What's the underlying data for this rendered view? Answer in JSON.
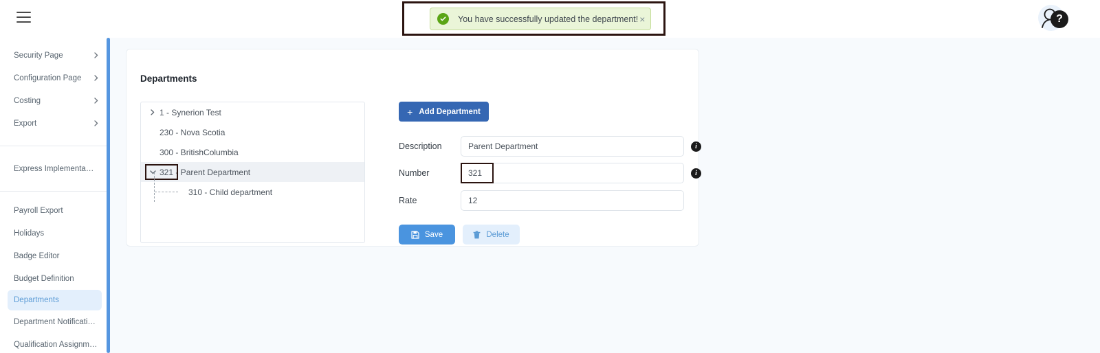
{
  "topbar": {
    "menu_icon": "hamburger-icon",
    "avatar_icon": "user-avatar-icon",
    "help_badge": "?"
  },
  "toast": {
    "message": "You have successfully updated the department!",
    "close_label": "×",
    "status_icon": "check-circle-icon",
    "bg_color": "#eaf5d8",
    "border_color": "#c5dd9a",
    "check_color": "#5aa515"
  },
  "sidebar": {
    "group_expandable": [
      {
        "label": "Security Page",
        "chevron": "chevron-right-icon"
      },
      {
        "label": "Configuration Page",
        "chevron": "chevron-right-icon"
      },
      {
        "label": "Costing",
        "chevron": "chevron-right-icon"
      },
      {
        "label": "Export",
        "chevron": "chevron-right-icon"
      }
    ],
    "group_express": [
      {
        "label": "Express Implementation P..."
      }
    ],
    "group_pages": [
      {
        "label": "Payroll Export",
        "active": false
      },
      {
        "label": "Holidays",
        "active": false
      },
      {
        "label": "Badge Editor",
        "active": false
      },
      {
        "label": "Budget Definition",
        "active": false
      },
      {
        "label": "Departments",
        "active": true
      },
      {
        "label": "Department Notifications",
        "active": false
      },
      {
        "label": "Qualification Assignments",
        "active": false
      }
    ],
    "active_color": "#5b9bd5",
    "active_bg": "#e3effc",
    "scrollbar_color": "#5596e0"
  },
  "main": {
    "card_title": "Departments",
    "tree": [
      {
        "label": "1 - Synerion Test",
        "chevron": "chevron-right-icon",
        "level": 0,
        "selected": false
      },
      {
        "label": "230 - Nova Scotia",
        "chevron": "",
        "level": 0,
        "selected": false
      },
      {
        "label": "300 - BritishColumbia",
        "chevron": "",
        "level": 0,
        "selected": false
      },
      {
        "label": "321 - Parent Department",
        "chevron": "chevron-down-icon",
        "level": 0,
        "selected": true
      },
      {
        "label": "310 - Child department",
        "chevron": "",
        "level": 1,
        "selected": false
      }
    ],
    "add_button": {
      "label": "Add Department",
      "plus": "+",
      "color": "#3567b3"
    },
    "fields": [
      {
        "label": "Description",
        "value": "Parent Department",
        "info": true
      },
      {
        "label": "Number",
        "value": "321",
        "info": true
      },
      {
        "label": "Rate",
        "value": "12",
        "info": false
      }
    ],
    "buttons": {
      "save": {
        "label": "Save",
        "icon": "save-floppy-icon",
        "color": "#4a94df"
      },
      "delete": {
        "label": "Delete",
        "icon": "trash-icon",
        "color": "#e3effc"
      }
    },
    "info_glyph": "i"
  },
  "annotations": {
    "color": "#2b1410",
    "toast_box": "highlight-toast",
    "tree_number_box": "highlight-tree-number",
    "number_field_box": "highlight-number-field"
  }
}
